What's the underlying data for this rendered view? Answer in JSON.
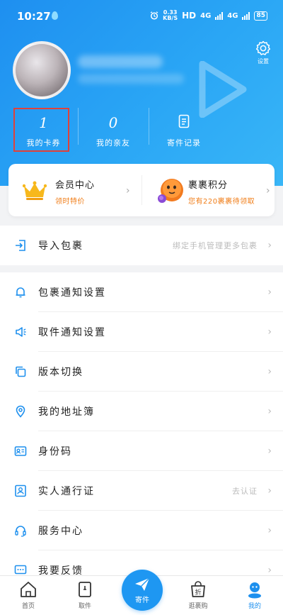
{
  "status_bar": {
    "time": "10:27",
    "speed_value": "0.33",
    "speed_unit": "KB/S",
    "hd": "HD",
    "net1": "4G",
    "net2": "4G",
    "battery": "85"
  },
  "profile": {
    "settings_label": "设置"
  },
  "stats": [
    {
      "value": "1",
      "label": "我的卡券"
    },
    {
      "value": "0",
      "label": "我的亲友"
    },
    {
      "value": "",
      "label": "寄件记录"
    }
  ],
  "member_card": {
    "left": {
      "title": "会员中心",
      "subtitle": "领时特价"
    },
    "right": {
      "title": "裹裹积分",
      "subtitle": "您有220裹裹待领取"
    }
  },
  "import_row": {
    "label": "导入包裹",
    "value": "绑定手机管理更多包裹"
  },
  "settings_rows": [
    {
      "label": "包裹通知设置",
      "value": ""
    },
    {
      "label": "取件通知设置",
      "value": ""
    },
    {
      "label": "版本切换",
      "value": ""
    },
    {
      "label": "我的地址簿",
      "value": ""
    },
    {
      "label": "身份码",
      "value": ""
    },
    {
      "label": "实人通行证",
      "value": "去认证"
    },
    {
      "label": "服务中心",
      "value": ""
    },
    {
      "label": "我要反馈",
      "value": ""
    }
  ],
  "bottom_nav": {
    "home": "首页",
    "pickup": "取件",
    "send": "寄件",
    "shop": "逛裹购",
    "mine": "我的"
  },
  "colors": {
    "primary": "#1e90ee",
    "header_gradient_start": "#1e8ff0",
    "header_gradient_end": "#39b6f7",
    "accent_orange": "#f07d18",
    "highlight_red": "#e0413a"
  }
}
